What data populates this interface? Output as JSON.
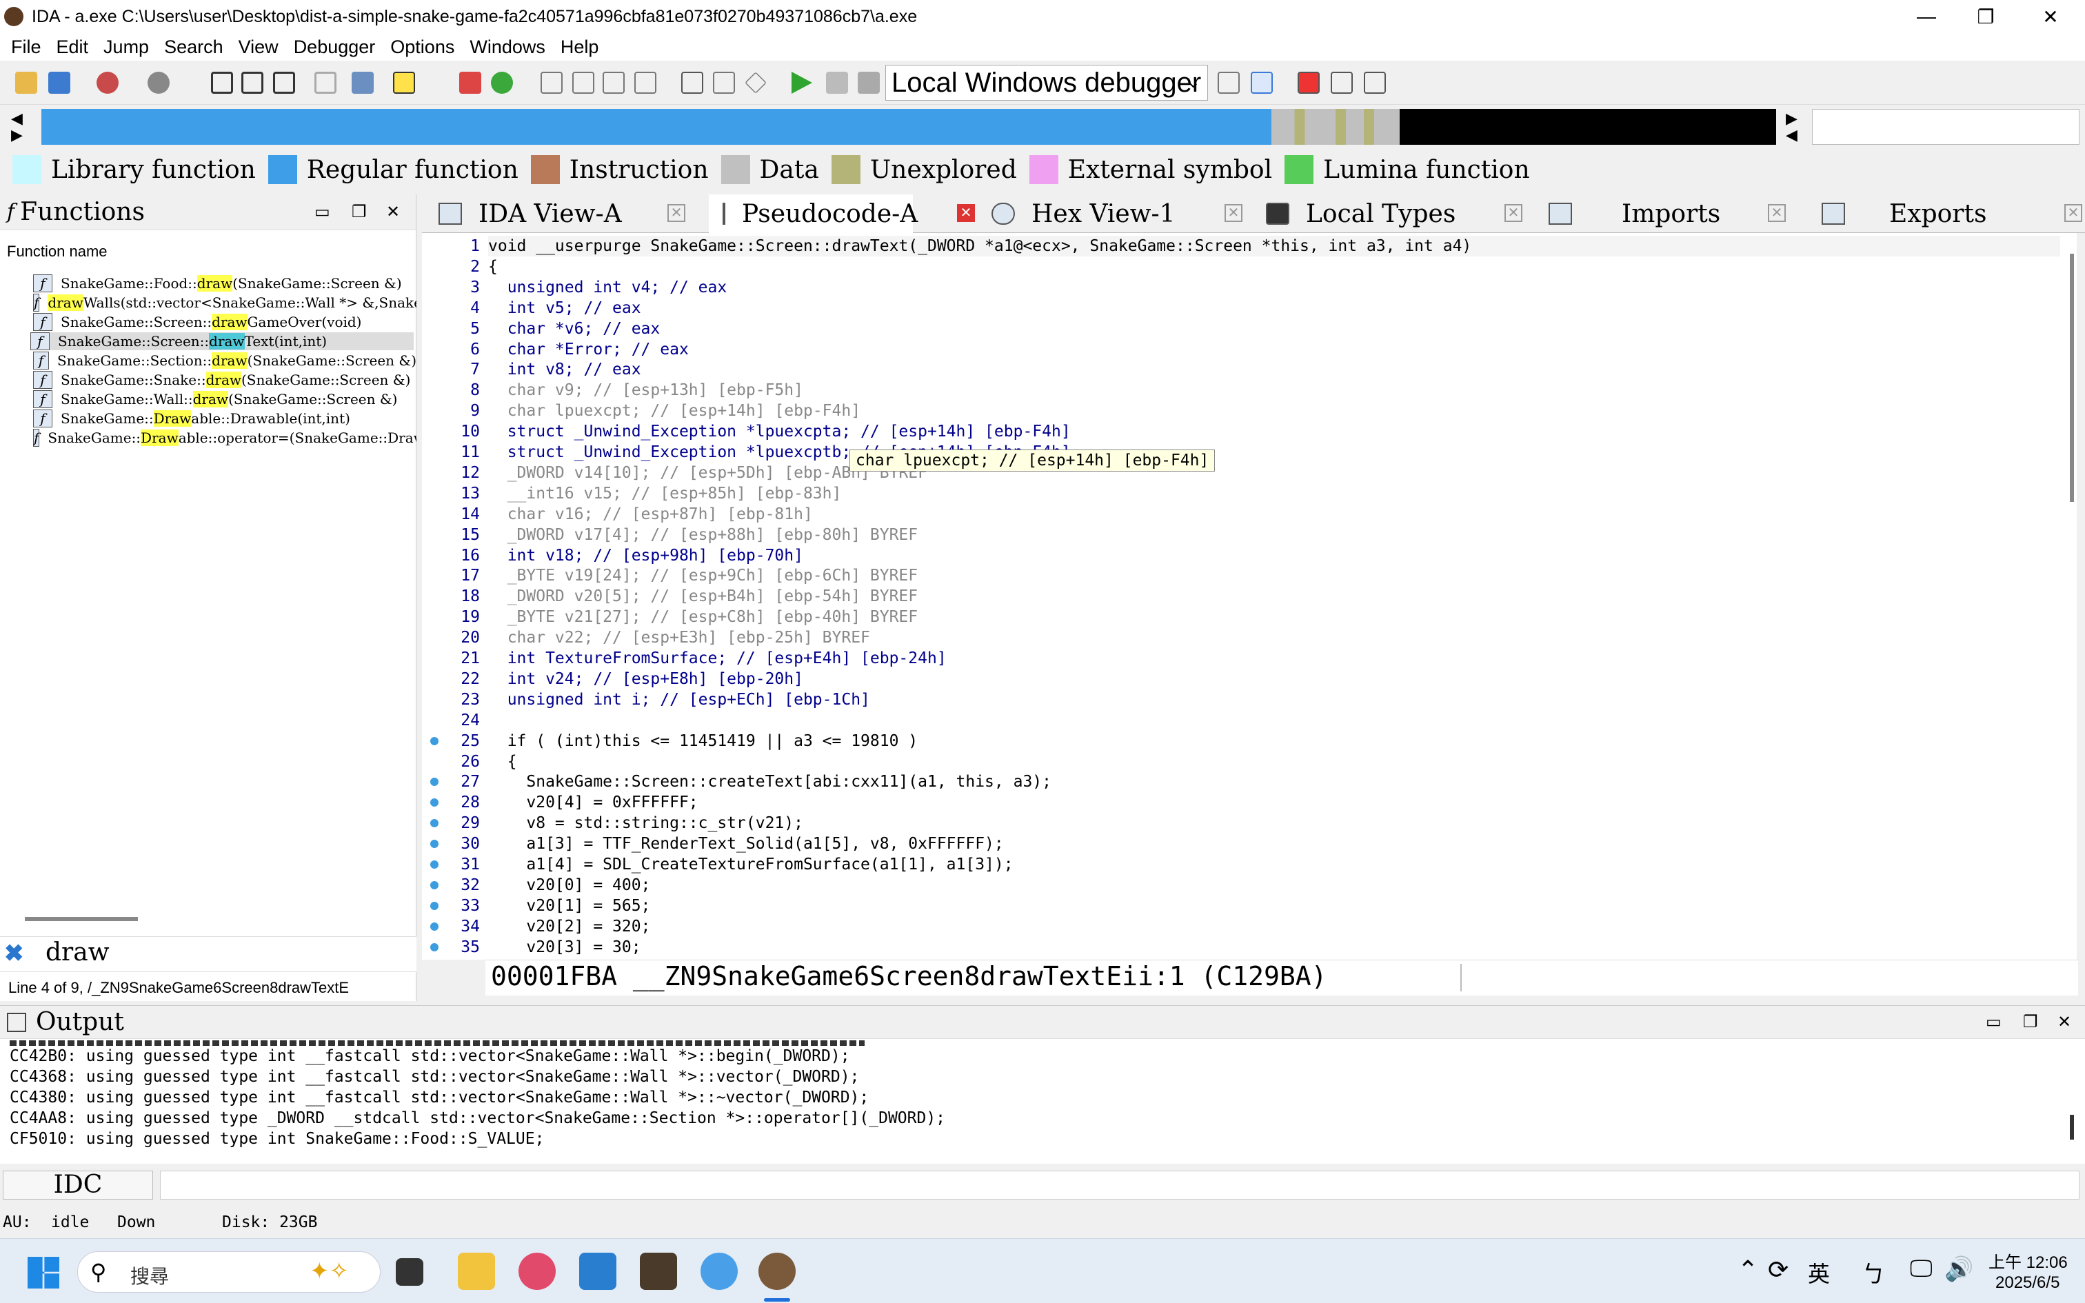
{
  "window": {
    "title": "IDA - a.exe C:\\Users\\user\\Desktop\\dist-a-simple-snake-game-fa2c40571a996cbfa81e073f0270b49371086cb7\\a.exe"
  },
  "menu": [
    "File",
    "Edit",
    "Jump",
    "Search",
    "View",
    "Debugger",
    "Options",
    "Windows",
    "Help"
  ],
  "toolbar": {
    "debugger": "Local Windows debugger"
  },
  "legend": [
    {
      "label": "Library function",
      "color": "#c8f8ff"
    },
    {
      "label": "Regular function",
      "color": "#3f9ee8"
    },
    {
      "label": "Instruction",
      "color": "#b97a5a"
    },
    {
      "label": "Data",
      "color": "#c0c0c0"
    },
    {
      "label": "Unexplored",
      "color": "#b4b478"
    },
    {
      "label": "External symbol",
      "color": "#f0a0f0"
    },
    {
      "label": "Lumina function",
      "color": "#58cc58"
    }
  ],
  "functions": {
    "title": "Functions",
    "column": "Function name",
    "items": [
      {
        "pre": "SnakeGame::Food::",
        "hl": "draw",
        "post": "(SnakeGame::Screen &)"
      },
      {
        "pre": "",
        "hl": "draw",
        "post": "Walls(std::vector<SnakeGame::Wall *> &,SnakeG"
      },
      {
        "pre": "SnakeGame::Screen::",
        "hl": "draw",
        "post": "GameOver(void)"
      },
      {
        "pre": "SnakeGame::Screen::",
        "hl": "draw",
        "post": "Text(int,int)"
      },
      {
        "pre": "SnakeGame::Section::",
        "hl": "draw",
        "post": "(SnakeGame::Screen &)"
      },
      {
        "pre": "SnakeGame::Snake::",
        "hl": "draw",
        "post": "(SnakeGame::Screen &)"
      },
      {
        "pre": "SnakeGame::Wall::",
        "hl": "draw",
        "post": "(SnakeGame::Screen &)"
      },
      {
        "pre": "SnakeGame::",
        "hl": "Draw",
        "post": "able::Drawable(int,int)"
      },
      {
        "pre": "SnakeGame::",
        "hl": "Draw",
        "post": "able::operator=(SnakeGame::Drawab"
      }
    ],
    "filter": "draw",
    "line_info": "Line 4 of 9, /_ZN9SnakeGame6Screen8drawTextE"
  },
  "tabs": [
    "IDA View-A",
    "Pseudocode-A",
    "Hex View-1",
    "Local Types",
    "Imports",
    "Exports"
  ],
  "code_lines": [
    "void __userpurge SnakeGame::Screen::drawText(_DWORD *a1@<ecx>, SnakeGame::Screen *this, int a3, int a4)",
    "{",
    "  unsigned int v4; // eax",
    "  int v5; // eax",
    "  char *v6; // eax",
    "  char *Error; // eax",
    "  int v8; // eax",
    "  char v9; // [esp+13h] [ebp-F5h]",
    "  char lpuexcpt; // [esp+14h] [ebp-F4h]",
    "  struct _Unwind_Exception *lpuexcpta; // [esp+14h] [ebp-F4h]",
    "  struct _Unwind_Exception *lpuexcptb; // [esp+14h] [ebp-F4h]",
    "  _DWORD v14[10]; // [esp+5Dh] [ebp-ABh] BYREF",
    "  __int16 v15; // [esp+85h] [ebp-83h]",
    "  char v16; // [esp+87h] [ebp-81h]",
    "  _DWORD v17[4]; // [esp+88h] [ebp-80h] BYREF",
    "  int v18; // [esp+98h] [ebp-70h]",
    "  _BYTE v19[24]; // [esp+9Ch] [ebp-6Ch] BYREF",
    "  _DWORD v20[5]; // [esp+B4h] [ebp-54h] BYREF",
    "  _BYTE v21[27]; // [esp+C8h] [ebp-40h] BYREF",
    "  char v22; // [esp+E3h] [ebp-25h] BYREF",
    "  int TextureFromSurface; // [esp+E4h] [ebp-24h]",
    "  int v24; // [esp+E8h] [ebp-20h]",
    "  unsigned int i; // [esp+ECh] [ebp-1Ch]",
    "",
    "  if ( (int)this <= 11451419 || a3 <= 19810 )",
    "  {",
    "    SnakeGame::Screen::createText[abi:cxx11](a1, this, a3);",
    "    v20[4] = 0xFFFFFF;",
    "    v8 = std::string::c_str(v21);",
    "    a1[3] = TTF_RenderText_Solid(a1[5], v8, 0xFFFFFF);",
    "    a1[4] = SDL_CreateTextureFromSurface(a1[1], a1[3]);",
    "    v20[0] = 400;",
    "    v20[1] = 565;",
    "    v20[2] = 320;",
    "    v20[3] = 30;"
  ],
  "tooltip": "char lpuexcpt; // [esp+14h] [ebp-F4h]",
  "address_bar": "00001FBA __ZN9SnakeGame6Screen8drawTextEii:1 (C129BA)",
  "output": {
    "title": "Output",
    "lines": [
      "CC42B0: using guessed type int __fastcall std::vector<SnakeGame::Wall *>::begin(_DWORD);",
      "CC4368: using guessed type int __fastcall std::vector<SnakeGame::Wall *>::vector(_DWORD);",
      "CC4380: using guessed type int __fastcall std::vector<SnakeGame::Wall *>::~vector(_DWORD);",
      "CC4AA8: using guessed type _DWORD __stdcall std::vector<SnakeGame::Section *>::operator[](_DWORD);",
      "CF5010: using guessed type int SnakeGame::Food::S_VALUE;"
    ]
  },
  "idc": "IDC",
  "status": {
    "au": "AU:",
    "state": "idle",
    "dir": "Down",
    "disk": "Disk: 23GB"
  },
  "taskbar": {
    "search": "搜尋",
    "ime": "英",
    "time": "上午 12:06",
    "date": "2025/6/5"
  }
}
